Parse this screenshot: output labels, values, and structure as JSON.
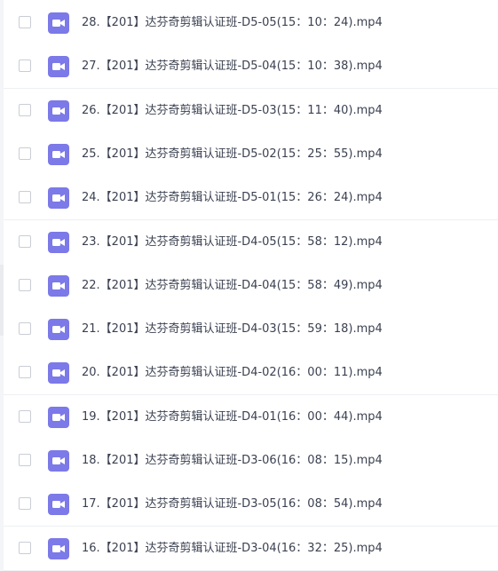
{
  "file_list": {
    "items": [
      {
        "name": "28.【201】达芬奇剪辑认证班-D5-05(15：10：24).mp4",
        "type_icon": "video-file-icon"
      },
      {
        "name": "27.【201】达芬奇剪辑认证班-D5-04(15：10：38).mp4",
        "type_icon": "video-file-icon"
      },
      {
        "name": "26.【201】达芬奇剪辑认证班-D5-03(15：11：40).mp4",
        "type_icon": "video-file-icon"
      },
      {
        "name": "25.【201】达芬奇剪辑认证班-D5-02(15：25：55).mp4",
        "type_icon": "video-file-icon"
      },
      {
        "name": "24.【201】达芬奇剪辑认证班-D5-01(15：26：24).mp4",
        "type_icon": "video-file-icon"
      },
      {
        "name": "23.【201】达芬奇剪辑认证班-D4-05(15：58：12).mp4",
        "type_icon": "video-file-icon"
      },
      {
        "name": "22.【201】达芬奇剪辑认证班-D4-04(15：58：49).mp4",
        "type_icon": "video-file-icon"
      },
      {
        "name": "21.【201】达芬奇剪辑认证班-D4-03(15：59：18).mp4",
        "type_icon": "video-file-icon"
      },
      {
        "name": "20.【201】达芬奇剪辑认证班-D4-02(16：00：11).mp4",
        "type_icon": "video-file-icon"
      },
      {
        "name": "19.【201】达芬奇剪辑认证班-D4-01(16：00：44).mp4",
        "type_icon": "video-file-icon"
      },
      {
        "name": "18.【201】达芬奇剪辑认证班-D3-06(16：08：15).mp4",
        "type_icon": "video-file-icon"
      },
      {
        "name": "17.【201】达芬奇剪辑认证班-D3-05(16：08：54).mp4",
        "type_icon": "video-file-icon"
      },
      {
        "name": "16.【201】达芬奇剪辑认证班-D3-04(16：32：25).mp4",
        "type_icon": "video-file-icon"
      }
    ]
  },
  "colors": {
    "video_icon": "#7c79e8",
    "text": "#3b4151",
    "checkbox_border": "#c9cdd4",
    "row_divider": "#eef0f3"
  }
}
